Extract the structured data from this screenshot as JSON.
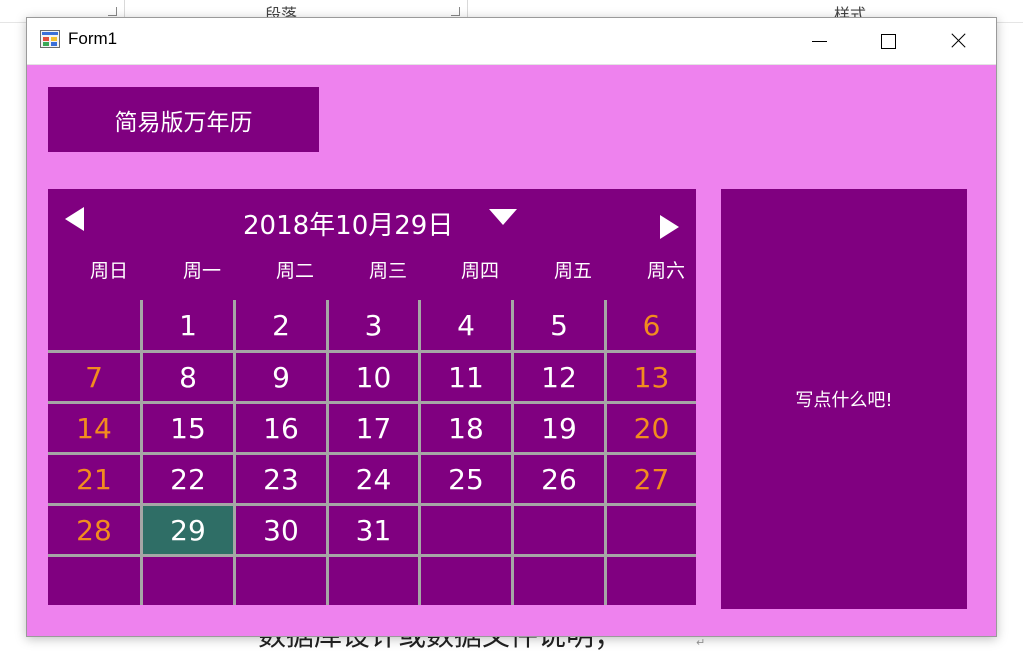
{
  "background": {
    "ribbon_labels": [
      "段落",
      "样式"
    ],
    "doc_text": "数据库设计或数据文件说明；",
    "paragraph_mark": "↵"
  },
  "window": {
    "title": "Form1",
    "icon": "winforms-app-icon",
    "controls": [
      "minimize-icon",
      "maximize-icon",
      "close-icon"
    ]
  },
  "header_button": {
    "label": "简易版万年历"
  },
  "calendar": {
    "title": "2018年10月29日",
    "weekdays": [
      "周日",
      "周一",
      "周二",
      "周三",
      "周四",
      "周五",
      "周六"
    ],
    "weeks": [
      [
        "",
        "1",
        "2",
        "3",
        "4",
        "5",
        "6"
      ],
      [
        "7",
        "8",
        "9",
        "10",
        "11",
        "12",
        "13"
      ],
      [
        "14",
        "15",
        "16",
        "17",
        "18",
        "19",
        "20"
      ],
      [
        "21",
        "22",
        "23",
        "24",
        "25",
        "26",
        "27"
      ],
      [
        "28",
        "29",
        "30",
        "31",
        "",
        "",
        ""
      ],
      [
        "",
        "",
        "",
        "",
        "",
        "",
        ""
      ]
    ],
    "selected_day": "29",
    "colors": {
      "panel": "#800080",
      "weekend": "#f28c1e",
      "selected": "#2f6e66",
      "grid": "#a6a6a6",
      "window_bg": "#ee82ee"
    }
  },
  "note_panel": {
    "label": "写点什么吧!"
  }
}
